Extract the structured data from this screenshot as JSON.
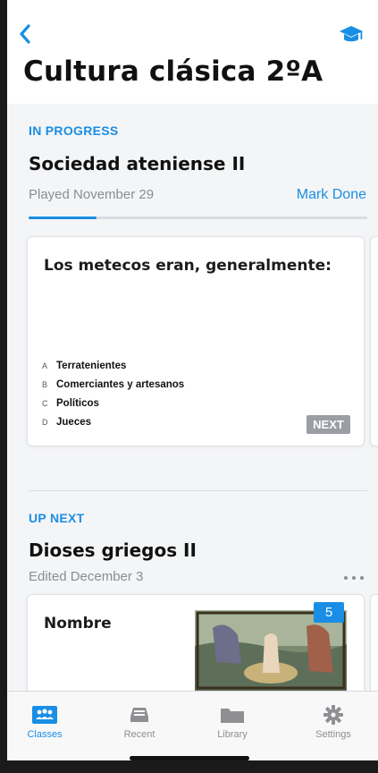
{
  "header": {
    "title": "Cultura clásica 2ºA",
    "back_icon": "chevron-left-icon",
    "class_icon": "graduation-cap-icon",
    "accent": "#1a8ee4"
  },
  "in_progress": {
    "label": "IN PROGRESS",
    "title": "Sociedad ateniense II",
    "meta": "Played November 29",
    "action": "Mark Done",
    "progress": 0.2,
    "card": {
      "question": "Los metecos eran, generalmente:",
      "options": [
        {
          "letter": "A",
          "text": "Terratenientes"
        },
        {
          "letter": "B",
          "text": "Comerciantes y artesanos"
        },
        {
          "letter": "C",
          "text": "Políticos"
        },
        {
          "letter": "D",
          "text": "Jueces"
        }
      ],
      "next_label": "NEXT"
    }
  },
  "up_next": {
    "label": "UP NEXT",
    "title": "Dioses griegos II",
    "meta": "Edited December 3",
    "more_icon": "more-horizontal-icon",
    "card": {
      "title": "Nombre",
      "badge": "5"
    }
  },
  "tabbar": {
    "items": [
      {
        "label": "Classes",
        "icon": "people-icon",
        "active": true
      },
      {
        "label": "Recent",
        "icon": "inbox-icon",
        "active": false
      },
      {
        "label": "Library",
        "icon": "folder-icon",
        "active": false
      },
      {
        "label": "Settings",
        "icon": "gear-icon",
        "active": false
      }
    ]
  }
}
